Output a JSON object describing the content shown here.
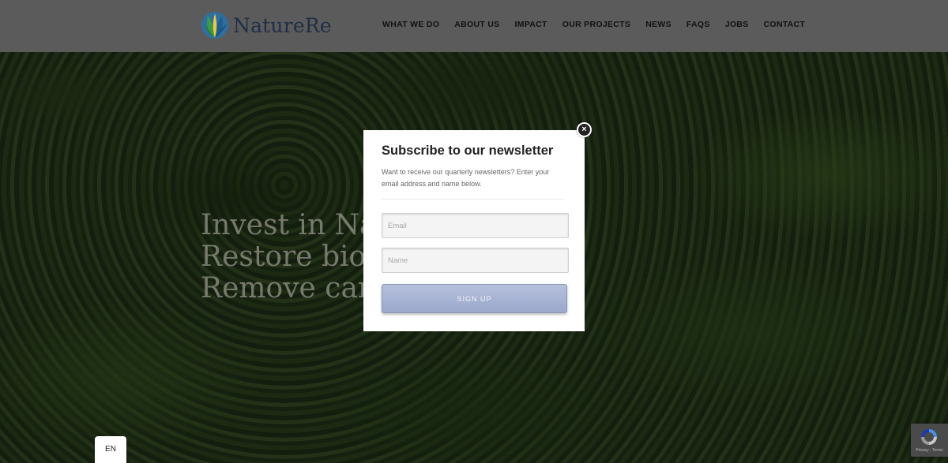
{
  "brand": {
    "name": "NatureRe",
    "logo_icon": "leaf-logo-icon"
  },
  "nav": {
    "items": [
      {
        "label": "WHAT WE DO"
      },
      {
        "label": "ABOUT US"
      },
      {
        "label": "IMPACT"
      },
      {
        "label": "OUR PROJECTS"
      },
      {
        "label": "NEWS"
      },
      {
        "label": "FAQS"
      },
      {
        "label": "JOBS"
      },
      {
        "label": "CONTACT"
      }
    ]
  },
  "hero": {
    "line1": "Invest in Nat",
    "line2": "Restore bioc",
    "line3": "Remove carl"
  },
  "modal": {
    "title": "Subscribe to our newsletter",
    "description": "Want to receive our quarterly newsletters? Enter your email address and name below.",
    "email_placeholder": "Email",
    "name_placeholder": "Name",
    "signup_label": "SIGN UP",
    "close_symbol": "×"
  },
  "language": {
    "current": "EN"
  },
  "recaptcha": {
    "terms": "Privacy - Terms"
  },
  "colors": {
    "header_bg": "#5b5b5b",
    "brand_text": "#1f2e45",
    "button_bg": "#a9b5d6"
  }
}
